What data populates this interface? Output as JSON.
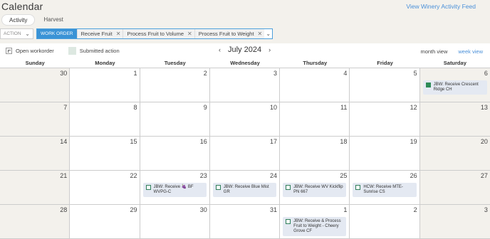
{
  "header": {
    "title": "Calendar",
    "feed_link": "View Winery Activity Feed"
  },
  "tabs": [
    {
      "label": "Activity",
      "active": true
    },
    {
      "label": "Harvest",
      "active": false
    }
  ],
  "filters": {
    "action_label": "ACTION",
    "type_chip": "WORK ORDER",
    "chips": [
      "Receive Fruit",
      "Process Fruit to Volume",
      "Process Fruit to Weight"
    ]
  },
  "legend": {
    "open_label": "Open workorder",
    "submitted_label": "Submitted action"
  },
  "nav": {
    "month_label": "July 2024",
    "prev": "‹",
    "next": "›"
  },
  "views": {
    "month": "month view",
    "week": "week view"
  },
  "weekdays": [
    "Sunday",
    "Monday",
    "Tuesday",
    "Wednesday",
    "Thursday",
    "Friday",
    "Saturday"
  ],
  "weeks": [
    [
      {
        "day": "30"
      },
      {
        "day": "1"
      },
      {
        "day": "2"
      },
      {
        "day": "3"
      },
      {
        "day": "4"
      },
      {
        "day": "5"
      },
      {
        "day": "6",
        "event": "JBW: Receive Crescent Ridge CH",
        "submitted": true
      }
    ],
    [
      {
        "day": "7"
      },
      {
        "day": "8"
      },
      {
        "day": "9"
      },
      {
        "day": "10"
      },
      {
        "day": "11"
      },
      {
        "day": "12"
      },
      {
        "day": "13"
      }
    ],
    [
      {
        "day": "14"
      },
      {
        "day": "15"
      },
      {
        "day": "16"
      },
      {
        "day": "17"
      },
      {
        "day": "18"
      },
      {
        "day": "19"
      },
      {
        "day": "20"
      }
    ],
    [
      {
        "day": "21"
      },
      {
        "day": "22"
      },
      {
        "day": "23",
        "event": "JBW: Receive 🍇 BF WVPG-C"
      },
      {
        "day": "24",
        "event": "JBW: Receive Blue Mist GR"
      },
      {
        "day": "25",
        "event": "JBW: Receive WV Kickflip PN 667"
      },
      {
        "day": "26",
        "event": "HCW: Receive MTE-Sunrise CS"
      },
      {
        "day": "27"
      }
    ],
    [
      {
        "day": "28"
      },
      {
        "day": "29"
      },
      {
        "day": "30"
      },
      {
        "day": "31"
      },
      {
        "day": "1",
        "event": "JBW: Receive & Process Fruit to Weight - Cheery Grove CF"
      },
      {
        "day": "2"
      },
      {
        "day": "3"
      }
    ]
  ],
  "colors": {
    "accent": "#3a93d6",
    "link": "#4a90d9",
    "weekend_bg": "#f3f1ec",
    "event_bg": "#e4e9f2",
    "submitted_green": "#2e8b57"
  }
}
